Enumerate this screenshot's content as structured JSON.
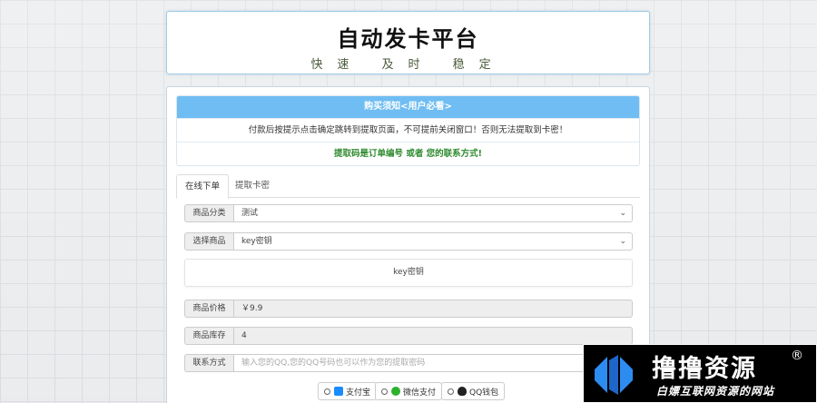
{
  "header": {
    "title": "自动发卡平台",
    "slogan": "快速 及时 稳定"
  },
  "notice": {
    "head": "购买须知<用户必看>",
    "line1": "付款后按提示点击确定跳转到提取页面，不可提前关闭窗口！否则无法提取到卡密！",
    "line2": "提取码是订单编号 或者 您的联系方式!"
  },
  "tabs": [
    {
      "label": "在线下单",
      "active": true
    },
    {
      "label": "提取卡密",
      "active": false
    }
  ],
  "form": {
    "category_label": "商品分类",
    "category_value": "测试",
    "product_label": "选择商品",
    "product_value": "key密钥",
    "description": "key密钥",
    "price_label": "商品价格",
    "price_value": "￥9.9",
    "stock_label": "商品库存",
    "stock_value": "4",
    "contact_label": "联系方式",
    "contact_placeholder": "输入您的QQ,您的QQ号码也可以作为您的提取密码"
  },
  "payment": [
    {
      "label": "支付宝",
      "icon": "alipay-icon",
      "color": "#1a8cff"
    },
    {
      "label": "微信支付",
      "icon": "wechat-icon",
      "color": "#2bb22b"
    },
    {
      "label": "QQ钱包",
      "icon": "qq-icon",
      "color": "#222222"
    }
  ],
  "watermark": {
    "main": "撸撸资源",
    "reg": "®",
    "sub": "白嫖互联网资源的网站"
  },
  "colors": {
    "accent": "#6fbdf2",
    "notice_green": "#2f8a2f"
  }
}
